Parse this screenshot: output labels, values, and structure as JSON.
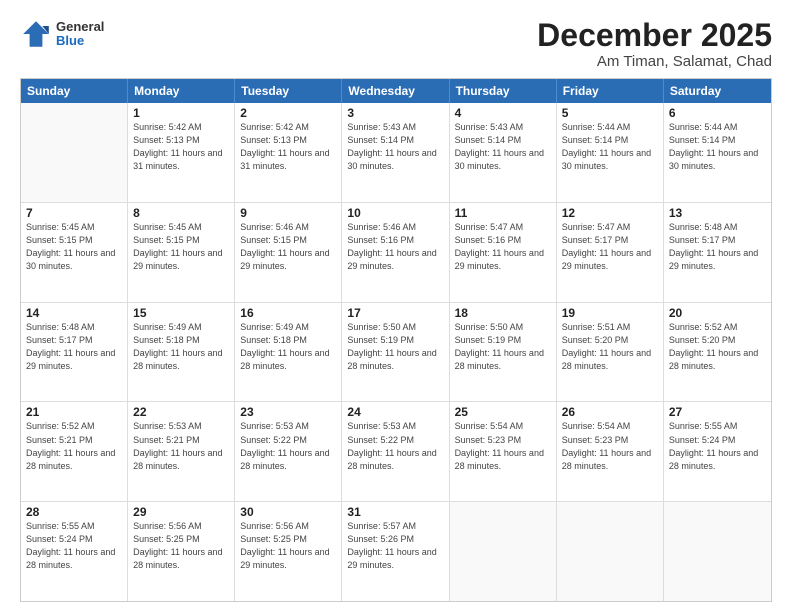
{
  "logo": {
    "general": "General",
    "blue": "Blue"
  },
  "title": "December 2025",
  "subtitle": "Am Timan, Salamat, Chad",
  "days_of_week": [
    "Sunday",
    "Monday",
    "Tuesday",
    "Wednesday",
    "Thursday",
    "Friday",
    "Saturday"
  ],
  "weeks": [
    [
      {
        "day": "",
        "empty": true
      },
      {
        "day": "1",
        "sunrise": "5:42 AM",
        "sunset": "5:13 PM",
        "daylight": "11 hours and 31 minutes."
      },
      {
        "day": "2",
        "sunrise": "5:42 AM",
        "sunset": "5:13 PM",
        "daylight": "11 hours and 31 minutes."
      },
      {
        "day": "3",
        "sunrise": "5:43 AM",
        "sunset": "5:14 PM",
        "daylight": "11 hours and 30 minutes."
      },
      {
        "day": "4",
        "sunrise": "5:43 AM",
        "sunset": "5:14 PM",
        "daylight": "11 hours and 30 minutes."
      },
      {
        "day": "5",
        "sunrise": "5:44 AM",
        "sunset": "5:14 PM",
        "daylight": "11 hours and 30 minutes."
      },
      {
        "day": "6",
        "sunrise": "5:44 AM",
        "sunset": "5:14 PM",
        "daylight": "11 hours and 30 minutes."
      }
    ],
    [
      {
        "day": "7",
        "sunrise": "5:45 AM",
        "sunset": "5:15 PM",
        "daylight": "11 hours and 30 minutes."
      },
      {
        "day": "8",
        "sunrise": "5:45 AM",
        "sunset": "5:15 PM",
        "daylight": "11 hours and 29 minutes."
      },
      {
        "day": "9",
        "sunrise": "5:46 AM",
        "sunset": "5:15 PM",
        "daylight": "11 hours and 29 minutes."
      },
      {
        "day": "10",
        "sunrise": "5:46 AM",
        "sunset": "5:16 PM",
        "daylight": "11 hours and 29 minutes."
      },
      {
        "day": "11",
        "sunrise": "5:47 AM",
        "sunset": "5:16 PM",
        "daylight": "11 hours and 29 minutes."
      },
      {
        "day": "12",
        "sunrise": "5:47 AM",
        "sunset": "5:17 PM",
        "daylight": "11 hours and 29 minutes."
      },
      {
        "day": "13",
        "sunrise": "5:48 AM",
        "sunset": "5:17 PM",
        "daylight": "11 hours and 29 minutes."
      }
    ],
    [
      {
        "day": "14",
        "sunrise": "5:48 AM",
        "sunset": "5:17 PM",
        "daylight": "11 hours and 29 minutes."
      },
      {
        "day": "15",
        "sunrise": "5:49 AM",
        "sunset": "5:18 PM",
        "daylight": "11 hours and 28 minutes."
      },
      {
        "day": "16",
        "sunrise": "5:49 AM",
        "sunset": "5:18 PM",
        "daylight": "11 hours and 28 minutes."
      },
      {
        "day": "17",
        "sunrise": "5:50 AM",
        "sunset": "5:19 PM",
        "daylight": "11 hours and 28 minutes."
      },
      {
        "day": "18",
        "sunrise": "5:50 AM",
        "sunset": "5:19 PM",
        "daylight": "11 hours and 28 minutes."
      },
      {
        "day": "19",
        "sunrise": "5:51 AM",
        "sunset": "5:20 PM",
        "daylight": "11 hours and 28 minutes."
      },
      {
        "day": "20",
        "sunrise": "5:52 AM",
        "sunset": "5:20 PM",
        "daylight": "11 hours and 28 minutes."
      }
    ],
    [
      {
        "day": "21",
        "sunrise": "5:52 AM",
        "sunset": "5:21 PM",
        "daylight": "11 hours and 28 minutes."
      },
      {
        "day": "22",
        "sunrise": "5:53 AM",
        "sunset": "5:21 PM",
        "daylight": "11 hours and 28 minutes."
      },
      {
        "day": "23",
        "sunrise": "5:53 AM",
        "sunset": "5:22 PM",
        "daylight": "11 hours and 28 minutes."
      },
      {
        "day": "24",
        "sunrise": "5:53 AM",
        "sunset": "5:22 PM",
        "daylight": "11 hours and 28 minutes."
      },
      {
        "day": "25",
        "sunrise": "5:54 AM",
        "sunset": "5:23 PM",
        "daylight": "11 hours and 28 minutes."
      },
      {
        "day": "26",
        "sunrise": "5:54 AM",
        "sunset": "5:23 PM",
        "daylight": "11 hours and 28 minutes."
      },
      {
        "day": "27",
        "sunrise": "5:55 AM",
        "sunset": "5:24 PM",
        "daylight": "11 hours and 28 minutes."
      }
    ],
    [
      {
        "day": "28",
        "sunrise": "5:55 AM",
        "sunset": "5:24 PM",
        "daylight": "11 hours and 28 minutes."
      },
      {
        "day": "29",
        "sunrise": "5:56 AM",
        "sunset": "5:25 PM",
        "daylight": "11 hours and 28 minutes."
      },
      {
        "day": "30",
        "sunrise": "5:56 AM",
        "sunset": "5:25 PM",
        "daylight": "11 hours and 29 minutes."
      },
      {
        "day": "31",
        "sunrise": "5:57 AM",
        "sunset": "5:26 PM",
        "daylight": "11 hours and 29 minutes."
      },
      {
        "day": "",
        "empty": true
      },
      {
        "day": "",
        "empty": true
      },
      {
        "day": "",
        "empty": true
      }
    ]
  ]
}
